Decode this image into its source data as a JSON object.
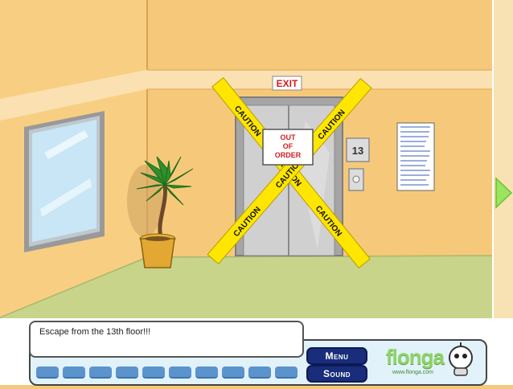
{
  "scene": {
    "exit_sign": "EXIT",
    "caution_text": "CAUTION",
    "out_of_order_sign": [
      "OUT",
      "OF",
      "ORDER"
    ],
    "floor_number": "13"
  },
  "hud": {
    "message": "Escape from the 13th floor!!!",
    "menu_button": "Menu",
    "sound_button": "Sound",
    "brand": "flonga",
    "brand_url": "www.flonga.com",
    "inventory_slots": 10
  },
  "colors": {
    "wall": "#f6c97a",
    "floor": "#c7d48a",
    "caution_tape": "#ffe600",
    "button_navy": "#1a2d7a",
    "brand_green": "#8ed36a"
  }
}
